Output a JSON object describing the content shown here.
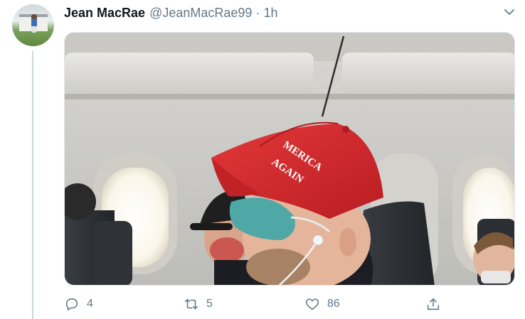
{
  "tweet": {
    "author_name": "Jean MacRae",
    "handle": "@JeanMacRae99",
    "separator": "·",
    "time": "1h"
  },
  "photo": {
    "cap_text_line1": "MERICA",
    "cap_text_line2": "AGAIN"
  },
  "actions": {
    "reply_count": "4",
    "retweet_count": "5",
    "like_count": "86"
  },
  "icons": {
    "caret": "chevron-down-icon",
    "reply": "reply-icon",
    "retweet": "retweet-icon",
    "like": "heart-icon",
    "share": "share-icon"
  },
  "colors": {
    "action_gray": "#657786",
    "cap_red": "#d52b2b",
    "mask_teal": "#4fa7a6"
  }
}
